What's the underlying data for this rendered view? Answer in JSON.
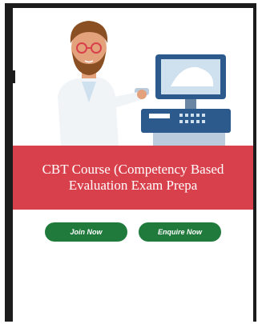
{
  "course": {
    "title_line1": "CBT Course (Competency Based",
    "title_line2": "Evaluation Exam Prepa"
  },
  "actions": {
    "join_label": "Join Now",
    "enquire_label": "Enquire Now"
  },
  "colors": {
    "banner": "#d8404c",
    "button": "#1f7a3c",
    "frame": "#1c1c1c"
  },
  "illustration": {
    "icon": "doctor-ultrasound-illustration"
  }
}
